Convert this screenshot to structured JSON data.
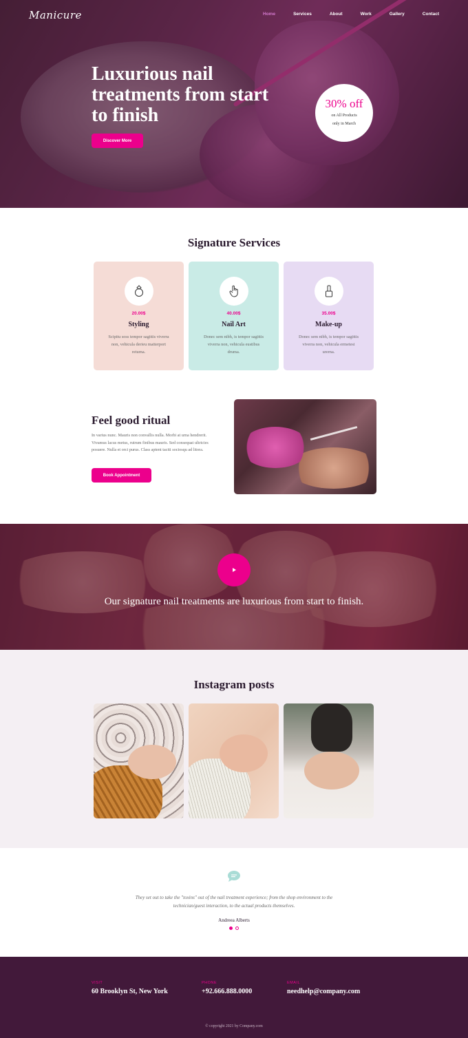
{
  "nav": {
    "logo": "Manicure",
    "links": [
      "Home",
      "Services",
      "About",
      "Work",
      "Gallery",
      "Contact"
    ],
    "active": "Home"
  },
  "hero": {
    "title": "Luxurious nail treatments from start to finish",
    "button": "Discover More",
    "promo_big": "30% off",
    "promo_line1": "on All Products",
    "promo_line2": "only in March"
  },
  "services": {
    "title": "Signature Services",
    "cards": [
      {
        "icon": "ring-icon",
        "price": "20.00$",
        "name": "Styling",
        "desc": "Scipitu soss tempor sagittis viverra non, vehicula derieu matterport returna.",
        "color": "#f5dcd6"
      },
      {
        "icon": "hand-pointer-icon",
        "price": "40.00$",
        "name": "Nail Art",
        "desc": "Donec sem nibh, is tempor sagittis viverra non, vehicula eustibus druma.",
        "color": "#c9ebe6"
      },
      {
        "icon": "nail-polish-icon",
        "price": "35.00$",
        "name": "Make-up",
        "desc": "Donec sem nibh, is tempor sagittis viverra non, vehicula ermetesi urerna.",
        "color": "#e7dbf3"
      }
    ]
  },
  "ritual": {
    "title": "Feel good ritual",
    "text": "In varius nunc. Mauris non convallis nulla. Morbi at urna hendrerit. Vivamus lacus metus, rutrum finibus mauris. Sed consequat ultricies posuere. Nulla et orci purus. Class aptent taciti sociosqu ad litora.",
    "button": "Book Appointment"
  },
  "banner": {
    "text": "Our signature nail treatments are luxurious from start to finish."
  },
  "instagram": {
    "title": "Instagram posts"
  },
  "testimonial": {
    "quote": "They set out to take the \"toxins\" out of the nail treatment experience; from the shop environment to the technician/guest interaction, to the actual products themselves.",
    "author": "Andreea Alberts"
  },
  "footer": {
    "visit_label": "VISIT",
    "visit_value": "60 Brooklyn St, New York",
    "phone_label": "PHONE",
    "phone_value": "+92.666.888.0000",
    "email_label": "EMAIL",
    "email_value": "needhelp@company.com",
    "copyright": "© copyright 2021 by Company.com"
  },
  "colors": {
    "accent": "#ec008c",
    "footer_bg": "#42193a",
    "insta_bg": "#f4eff3"
  }
}
